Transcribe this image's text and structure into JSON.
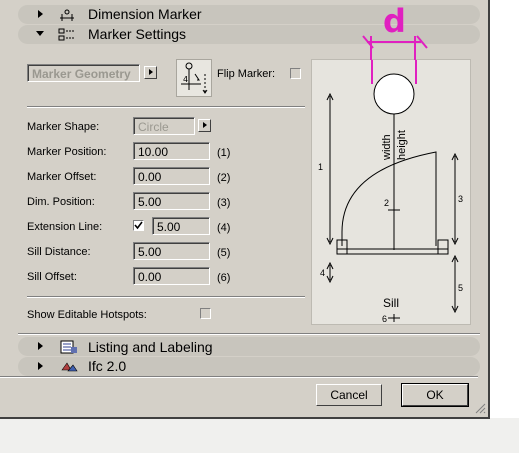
{
  "sections": {
    "dimension_marker": "Dimension Marker",
    "marker_settings": "Marker Settings",
    "listing_labeling": "Listing and Labeling",
    "ifc": "Ifc 2.0"
  },
  "geometry_dropdown": "Marker Geometry",
  "flip_marker_label": "Flip Marker:",
  "fields": [
    {
      "label": "Marker Shape:",
      "value": "Circle",
      "num": ""
    },
    {
      "label": "Marker Position:",
      "value": "10.00",
      "num": "(1)"
    },
    {
      "label": "Marker Offset:",
      "value": "0.00",
      "num": "(2)"
    },
    {
      "label": "Dim. Position:",
      "value": "5.00",
      "num": "(3)"
    },
    {
      "label": "Extension Line:",
      "value": "5.00",
      "num": "(4)"
    },
    {
      "label": "Sill Distance:",
      "value": "5.00",
      "num": "(5)"
    },
    {
      "label": "Sill Offset:",
      "value": "0.00",
      "num": "(6)"
    }
  ],
  "hotspots_label": "Show Editable Hotspots:",
  "diagram": {
    "d_label": "d",
    "width_label": "width",
    "height_label": "height",
    "sill_label": "Sill",
    "n1": "1",
    "n2": "2",
    "n3": "3",
    "n4": "4",
    "n5": "5",
    "n6": "6"
  },
  "buttons": {
    "cancel": "Cancel",
    "ok": "OK"
  },
  "colors": {
    "annotation": "#e020c0"
  }
}
